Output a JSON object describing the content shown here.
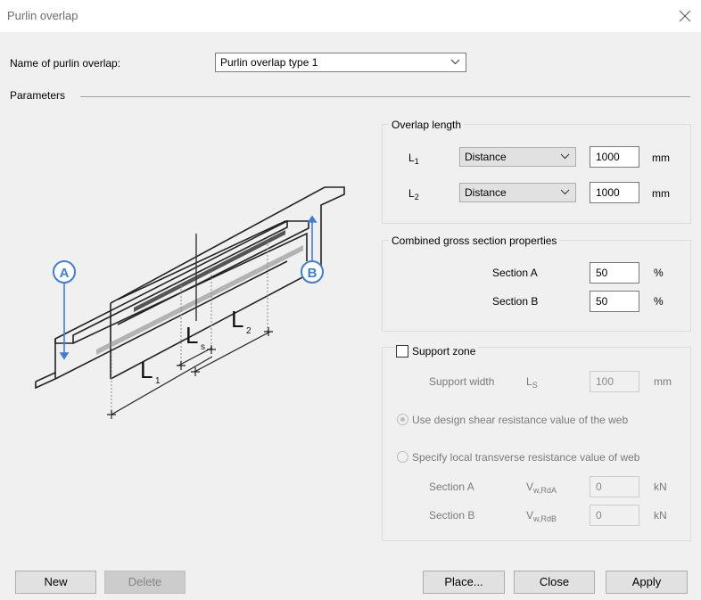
{
  "window": {
    "title": "Purlin overlap"
  },
  "name_row": {
    "label": "Name of purlin overlap:",
    "value": "Purlin overlap type 1"
  },
  "parameters": {
    "label": "Parameters"
  },
  "diagram": {
    "marker_a": "A",
    "marker_b": "B",
    "l1": "L",
    "l1_sub": "1",
    "l2": "L",
    "l2_sub": "2",
    "ls": "L",
    "ls_sub": "s"
  },
  "overlap_length": {
    "title": "Overlap length",
    "l1_label": "L",
    "l1_sub": "1",
    "l1_type": "Distance",
    "l1_value": "1000",
    "l1_unit": "mm",
    "l2_label": "L",
    "l2_sub": "2",
    "l2_type": "Distance",
    "l2_value": "1000",
    "l2_unit": "mm"
  },
  "combined": {
    "title": "Combined gross section properties",
    "section_a_label": "Section A",
    "section_a_value": "50",
    "section_a_unit": "%",
    "section_b_label": "Section B",
    "section_b_value": "50",
    "section_b_unit": "%"
  },
  "support_zone": {
    "title": "Support zone",
    "checked": false,
    "width_label": "Support width",
    "width_symbol": "L",
    "width_symbol_sub": "S",
    "width_value": "100",
    "width_unit": "mm",
    "radio_1": "Use design shear resistance value of the web",
    "radio_2": "Specify local transverse resistance value of web",
    "sec_a_label": "Section A",
    "sec_a_symbol": "V",
    "sec_a_symbol_sub": "w,RdA",
    "sec_a_value": "0",
    "sec_a_unit": "kN",
    "sec_b_label": "Section B",
    "sec_b_symbol": "V",
    "sec_b_symbol_sub": "w,RdB",
    "sec_b_value": "0",
    "sec_b_unit": "kN"
  },
  "buttons": {
    "new": "New",
    "delete": "Delete",
    "place": "Place...",
    "close": "Close",
    "apply": "Apply"
  }
}
